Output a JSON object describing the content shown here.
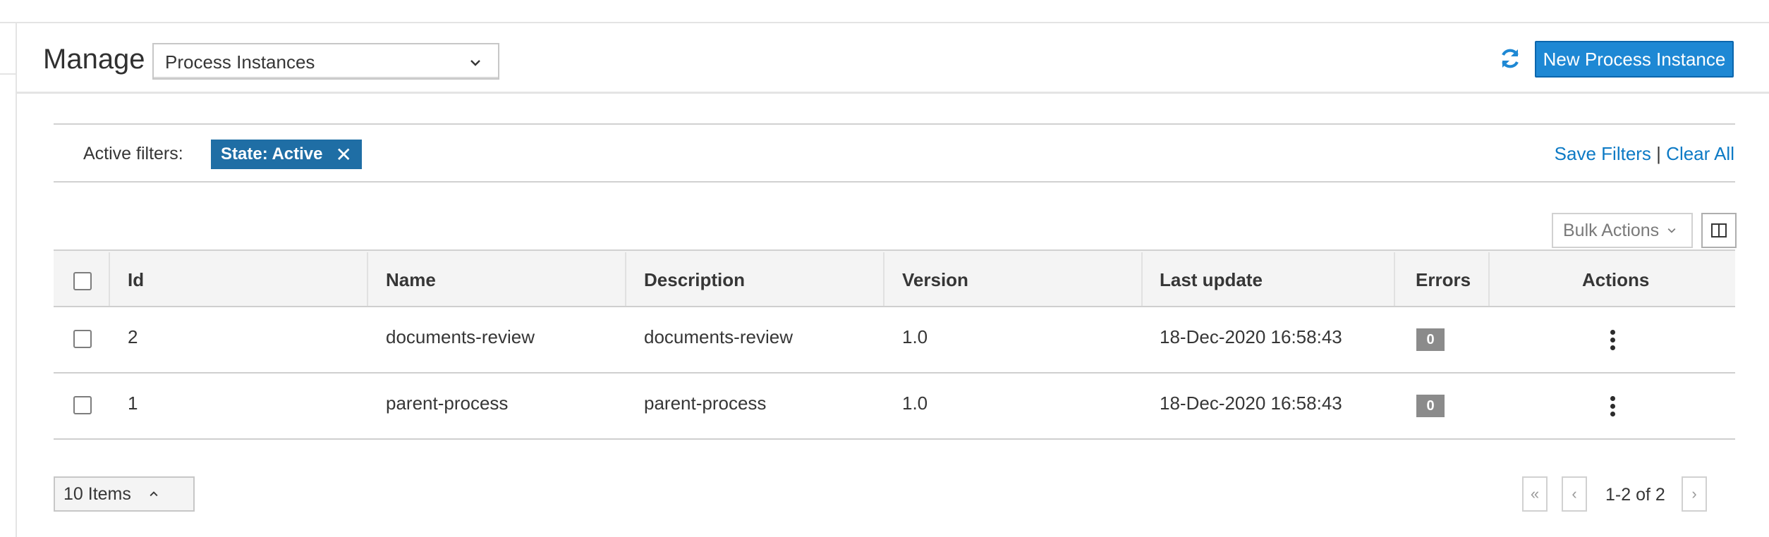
{
  "header": {
    "title": "Manage",
    "view_select": "Process Instances",
    "refresh_icon": "refresh-icon",
    "new_button": "New Process Instance"
  },
  "filters": {
    "label": "Active filters:",
    "chips": [
      {
        "label": "State: Active"
      }
    ],
    "save_link": "Save Filters",
    "separator": "|",
    "clear_link": "Clear All"
  },
  "toolbar": {
    "bulk_actions": "Bulk Actions",
    "columns_icon": "columns-icon"
  },
  "table": {
    "columns": [
      "Id",
      "Name",
      "Description",
      "Version",
      "Last update",
      "Errors",
      "Actions"
    ],
    "rows": [
      {
        "id": "2",
        "name": "documents-review",
        "description": "documents-review",
        "version": "1.0",
        "last_update": "18-Dec-2020 16:58:43",
        "errors": "0"
      },
      {
        "id": "1",
        "name": "parent-process",
        "description": "parent-process",
        "version": "1.0",
        "last_update": "18-Dec-2020 16:58:43",
        "errors": "0"
      }
    ]
  },
  "pagination": {
    "per_page": "10 Items",
    "range": "1-2 of 2"
  },
  "colors": {
    "primary": "#1e88d4",
    "chip": "#1f6ea5",
    "link": "#0d7ac5",
    "badge": "#8b8b8b"
  }
}
